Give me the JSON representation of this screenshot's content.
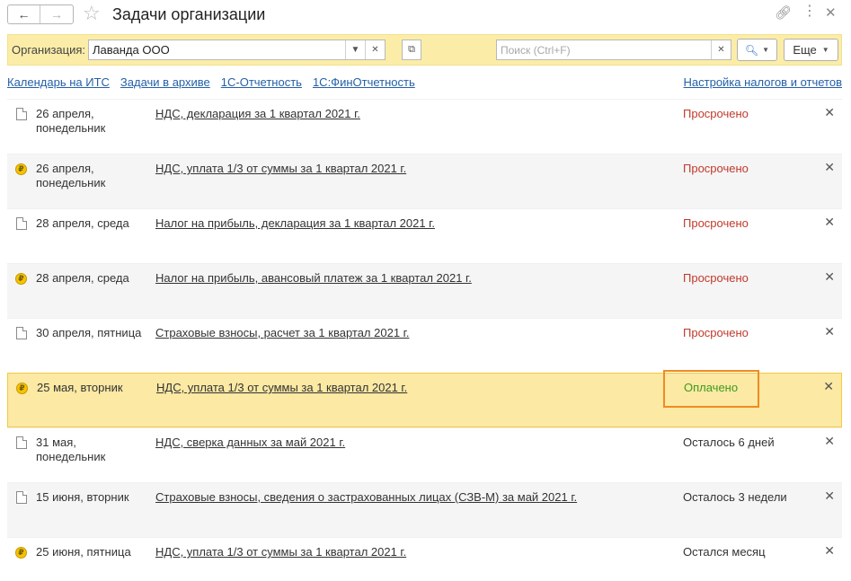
{
  "window": {
    "title": "Задачи организации"
  },
  "toolbar": {
    "org_label": "Организация:",
    "org_value": "Лаванда ООО",
    "search_placeholder": "Поиск (Ctrl+F)",
    "more_label": "Еще"
  },
  "links": {
    "left": [
      "Календарь на ИТС",
      "Задачи в архиве",
      "1С-Отчетность",
      "1С:ФинОтчетность"
    ],
    "right": "Настройка налогов и отчетов"
  },
  "colors": {
    "overdue": "#c0392b",
    "paid": "#3c9b1e",
    "selected_bg": "#fbe9a4",
    "highlight_border": "#f08a24"
  },
  "tasks": [
    {
      "icon": "document-icon",
      "date": "26 апреля,",
      "weekday": "понедельник",
      "title": "НДС, декларация за 1 квартал 2021 г.",
      "status": "Просрочено",
      "status_type": "overdue",
      "selected": false
    },
    {
      "icon": "ruble-coin-icon",
      "date": "26 апреля,",
      "weekday": "понедельник",
      "title": "НДС, уплата 1/3 от суммы за 1 квартал 2021 г.",
      "status": "Просрочено",
      "status_type": "overdue",
      "selected": false
    },
    {
      "icon": "document-icon",
      "date": "28 апреля, среда",
      "weekday": "",
      "title": "Налог на прибыль, декларация за 1 квартал 2021 г.",
      "status": "Просрочено",
      "status_type": "overdue",
      "selected": false
    },
    {
      "icon": "ruble-coin-icon",
      "date": "28 апреля, среда",
      "weekday": "",
      "title": "Налог на прибыль, авансовый платеж за 1 квартал 2021 г.",
      "status": "Просрочено",
      "status_type": "overdue",
      "selected": false
    },
    {
      "icon": "document-icon",
      "date": "30 апреля, пятница",
      "weekday": "",
      "title": "Страховые взносы, расчет за 1 квартал 2021 г.",
      "status": "Просрочено",
      "status_type": "overdue",
      "selected": false
    },
    {
      "icon": "ruble-coin-icon",
      "date": "25 мая, вторник",
      "weekday": "",
      "title": "НДС, уплата 1/3 от суммы за 1 квартал 2021 г.",
      "status": "Оплачено",
      "status_type": "paid",
      "selected": true
    },
    {
      "icon": "document-icon",
      "date": "31 мая,",
      "weekday": "понедельник",
      "title": "НДС, сверка данных за май 2021 г.",
      "status": "Осталось 6 дней",
      "status_type": "normal",
      "selected": false
    },
    {
      "icon": "document-icon",
      "date": "15 июня, вторник",
      "weekday": "",
      "title": "Страховые взносы, сведения о застрахованных лицах (СЗВ-М) за май 2021 г.",
      "status": "Осталось 3 недели",
      "status_type": "normal",
      "selected": false
    },
    {
      "icon": "ruble-coin-icon",
      "date": "25 июня, пятница",
      "weekday": "",
      "title": "НДС, уплата 1/3 от суммы за 1 квартал 2021 г.",
      "status": "Остался месяц",
      "status_type": "normal",
      "selected": false
    }
  ]
}
